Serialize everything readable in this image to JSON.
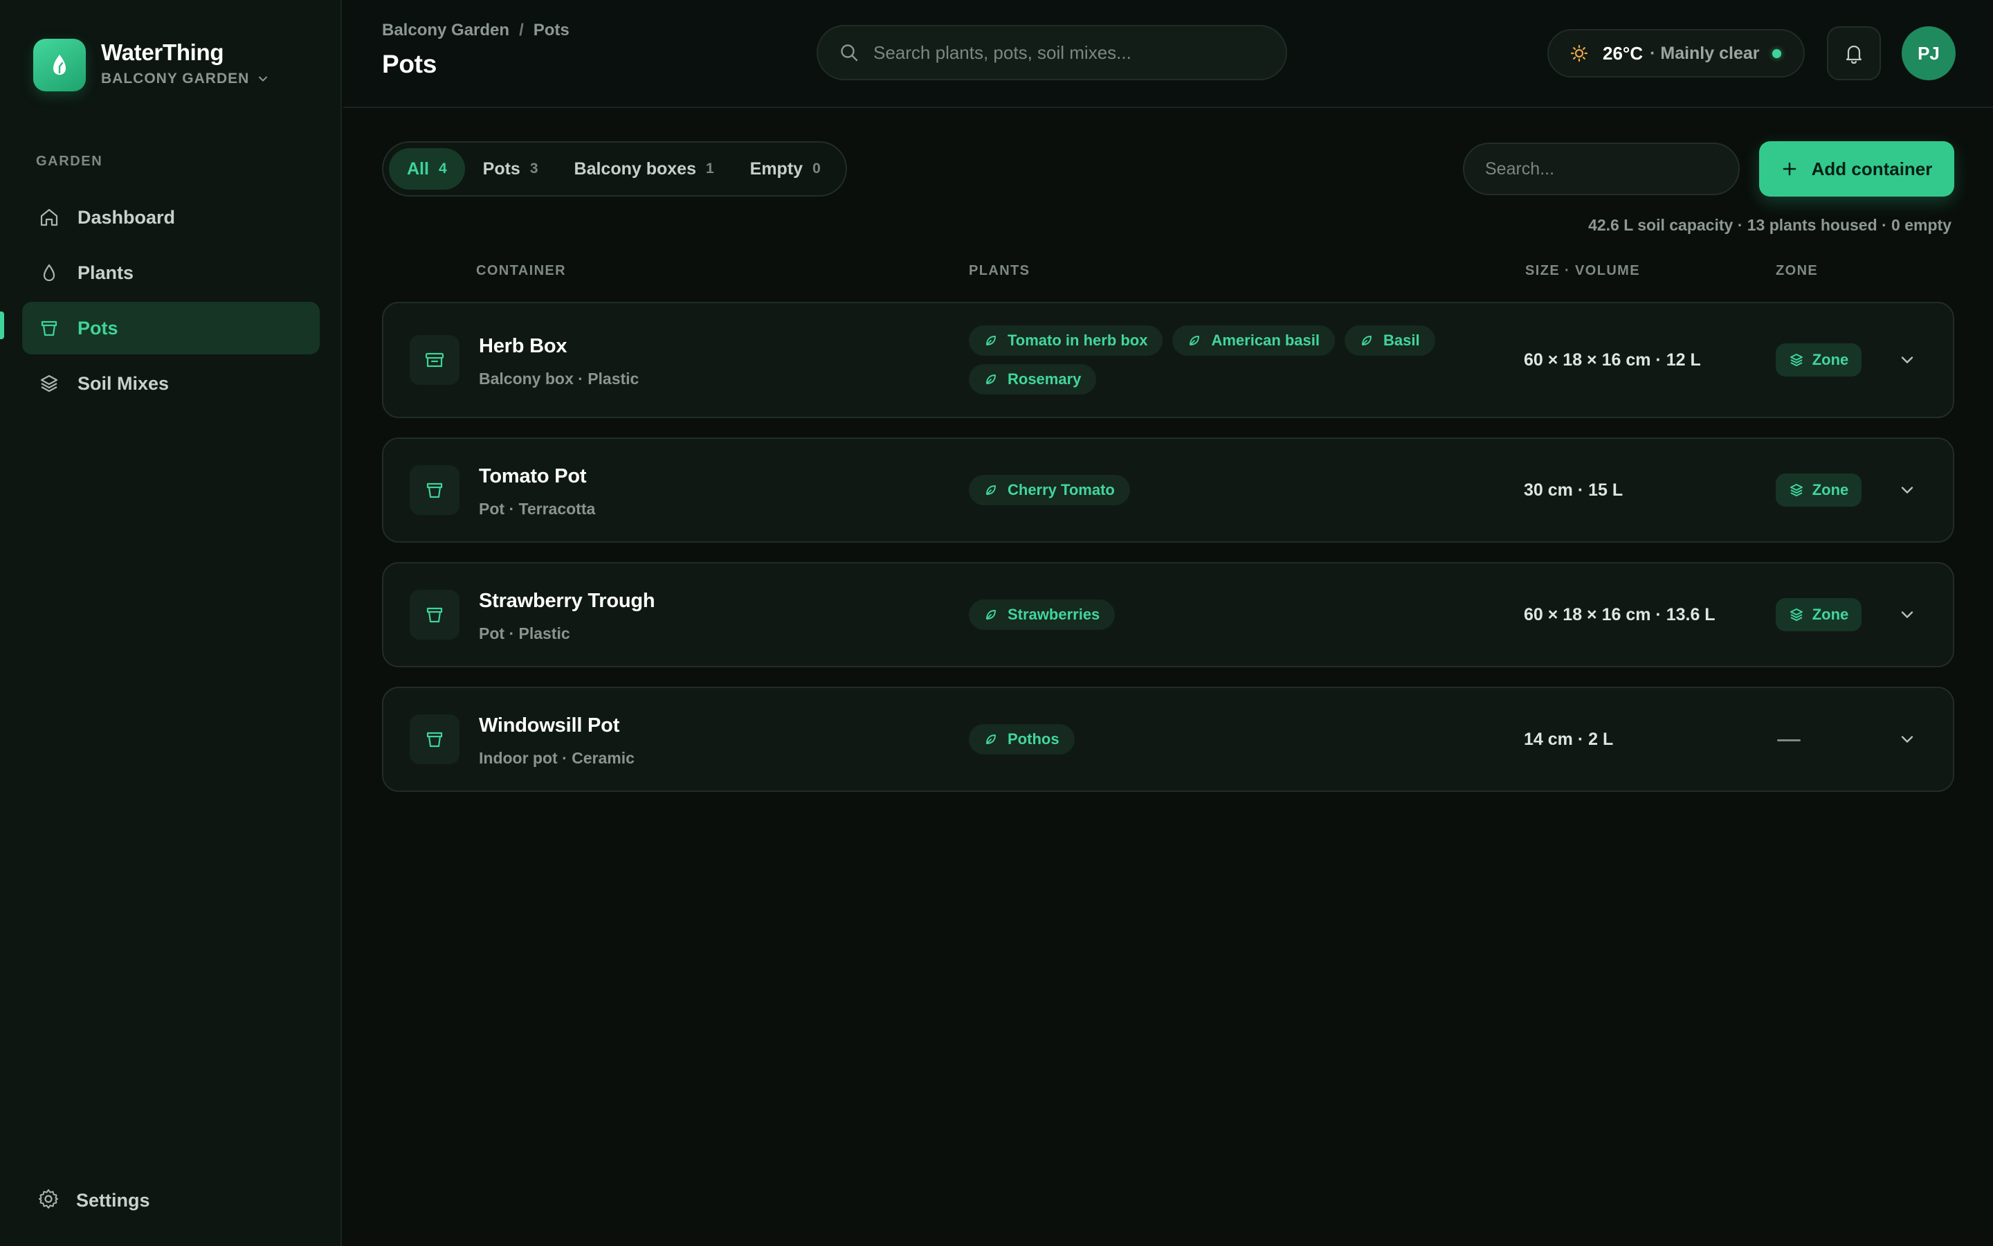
{
  "app": {
    "name": "WaterThing",
    "garden_name": "BALCONY GARDEN"
  },
  "sidebar": {
    "section_label": "GARDEN",
    "items": [
      {
        "label": "Dashboard",
        "icon": "home-icon"
      },
      {
        "label": "Plants",
        "icon": "drop-icon"
      },
      {
        "label": "Pots",
        "icon": "pot-icon",
        "active": true
      },
      {
        "label": "Soil Mixes",
        "icon": "layers-icon"
      }
    ],
    "settings_label": "Settings"
  },
  "header": {
    "breadcrumb": [
      "Balcony Garden",
      "Pots"
    ],
    "breadcrumb_sep": "/",
    "title": "Pots",
    "search_placeholder": "Search plants, pots, soil mixes...",
    "weather": {
      "temp": "26°C",
      "condition": "· Mainly clear"
    },
    "avatar_initials": "PJ"
  },
  "filters": [
    {
      "label": "All",
      "count": "4",
      "active": true
    },
    {
      "label": "Pots",
      "count": "3"
    },
    {
      "label": "Balcony boxes",
      "count": "1"
    },
    {
      "label": "Empty",
      "count": "0"
    }
  ],
  "list_search_placeholder": "Search...",
  "add_button_label": "Add container",
  "summary": "42.6 L soil capacity · 13 plants housed · 0 empty",
  "columns": {
    "container": "CONTAINER",
    "plants": "PLANTS",
    "size": "SIZE · VOLUME",
    "zone": "ZONE"
  },
  "containers": [
    {
      "name": "Herb Box",
      "meta": "Balcony box · Plastic",
      "plants": [
        "Tomato in herb box",
        "American basil",
        "Basil",
        "Rosemary"
      ],
      "size": "60 × 18 × 16 cm · 12 L",
      "zone": "Zone"
    },
    {
      "name": "Tomato Pot",
      "meta": "Pot · Terracotta",
      "plants": [
        "Cherry Tomato"
      ],
      "size": "30 cm · 15 L",
      "zone": "Zone"
    },
    {
      "name": "Strawberry Trough",
      "meta": "Pot · Plastic",
      "plants": [
        "Strawberries"
      ],
      "size": "60 × 18 × 16 cm · 13.6 L",
      "zone": "Zone"
    },
    {
      "name": "Windowsill Pot",
      "meta": "Indoor pot · Ceramic",
      "plants": [
        "Pothos"
      ],
      "size": "14 cm · 2 L",
      "zone": ""
    }
  ],
  "colors": {
    "accent": "#3fd49a",
    "background": "#0a0f0c",
    "sidebar": "#0d1611",
    "weather_icon": "#e8a64a"
  }
}
